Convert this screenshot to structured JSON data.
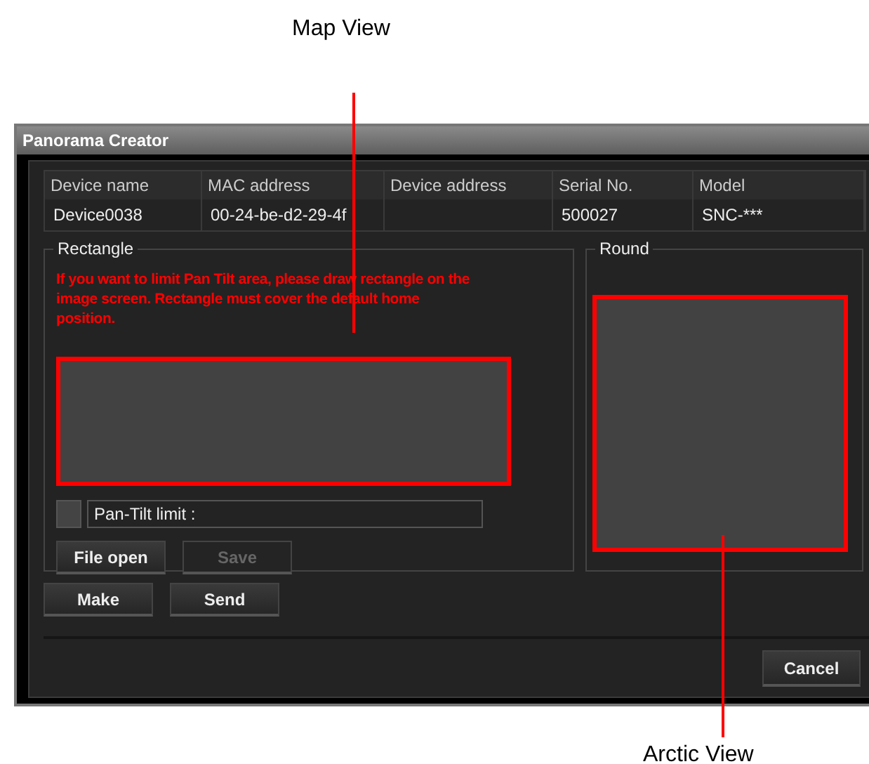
{
  "callouts": [
    {
      "label": "Map View"
    },
    {
      "label": "Arctic View"
    }
  ],
  "window": {
    "title": "Panorama Creator"
  },
  "table": {
    "columns": [
      "Device name",
      "MAC address",
      "Device address",
      "Serial No.",
      "Model"
    ],
    "rows": [
      [
        "Device0038",
        "00-24-be-d2-29-4f",
        "",
        "500027",
        "SNC-***"
      ]
    ]
  },
  "rectangle": {
    "legend": "Rectangle",
    "message": "If you want to limit Pan Tilt area, please draw rectangle on the image screen. Rectangle must cover the default home position.",
    "pan_tilt": {
      "label": "Pan-Tilt limit :",
      "checked": false
    },
    "buttons": [
      {
        "label": "File open",
        "disabled": false
      },
      {
        "label": "Save",
        "disabled": true
      }
    ]
  },
  "round": {
    "legend": "Round"
  },
  "actions": [
    {
      "label": "Make",
      "disabled": false
    },
    {
      "label": "Send",
      "disabled": false
    }
  ],
  "footer_buttons": [
    {
      "label": "Cancel",
      "disabled": false
    }
  ]
}
